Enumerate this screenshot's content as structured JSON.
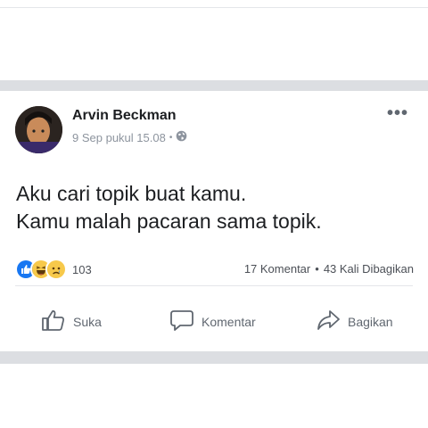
{
  "post": {
    "author": "Arvin Beckman",
    "timestamp": "9 Sep pukul 15.08",
    "separator": "•",
    "privacy_icon": "globe-icon",
    "more_label": "•••",
    "text_lines": [
      "Aku cari topik buat kamu.",
      "Kamu malah pacaran sama topik."
    ],
    "reactions": {
      "icons": [
        "like-reaction-icon",
        "haha-reaction-icon",
        "sad-reaction-icon"
      ],
      "count": "103"
    },
    "stats": {
      "comments": "17 Komentar",
      "separator": "•",
      "shares": "43 Kali Dibagikan"
    },
    "actions": {
      "like": "Suka",
      "comment": "Komentar",
      "share": "Bagikan"
    }
  },
  "colors": {
    "like_blue": "#1877f2",
    "haha_yellow": "#f7c94b",
    "muted_text": "#8d949e",
    "band_gray": "#dcdee2"
  }
}
